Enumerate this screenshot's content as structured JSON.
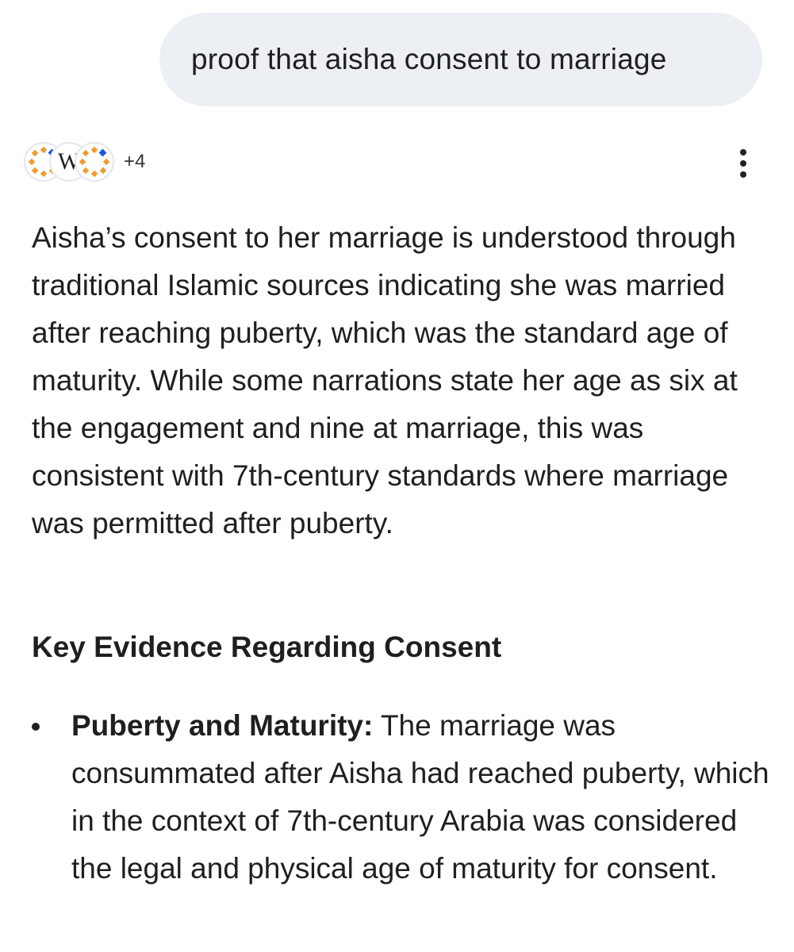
{
  "query": {
    "text": "proof that aisha consent to marriage"
  },
  "sources": {
    "icons": [
      "islamic-site-icon",
      "wikipedia-icon",
      "islamic-site-icon"
    ],
    "wiki_letter": "W",
    "more_count": "+4"
  },
  "answer": {
    "paragraph": "Aisha’s consent to her marriage is understood through traditional Islamic sources indicating she was married after reaching puberty, which was the standard age of maturity. While some narrations state her age as six at the engagement and nine at marriage, this was consistent with 7th-century standards where marriage was permitted after puberty.",
    "heading": "Key Evidence Regarding Consent",
    "bullets": [
      {
        "term": "Puberty and Maturity:",
        "text": " The marriage was consummated after Aisha had reached puberty, which in the context of 7th-century Arabia was considered the legal and physical age of maturity for consent."
      }
    ]
  },
  "colors": {
    "bubble_bg": "#eceff4",
    "text": "#1f1f1f",
    "icon_orange": "#f29a2e",
    "icon_blue": "#1a56db"
  }
}
